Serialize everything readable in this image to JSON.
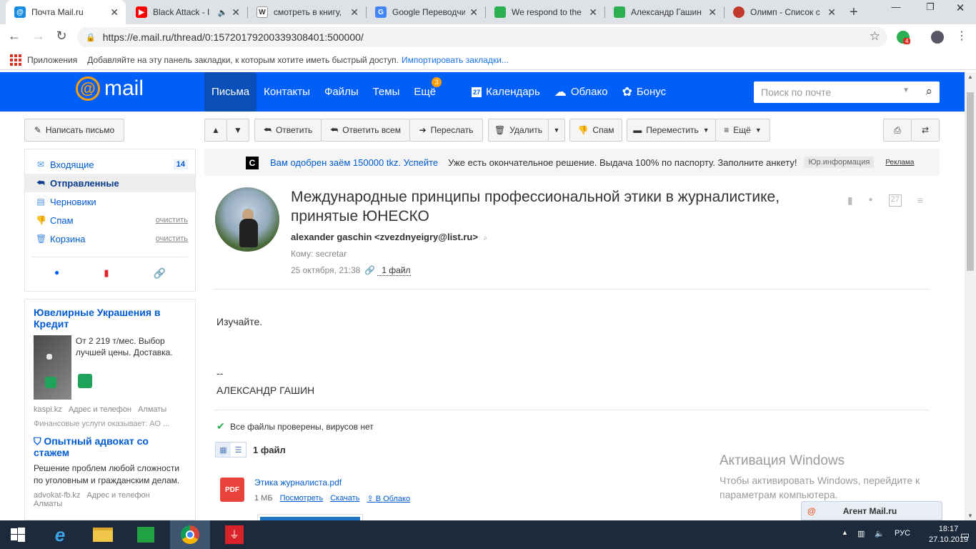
{
  "browser": {
    "tabs": [
      {
        "label": "Почта Mail.ru",
        "color": "#168de2"
      },
      {
        "label": "Black Attack - I",
        "color": "#ff0000"
      },
      {
        "label": "смотреть в книгу,",
        "color": "#555555"
      },
      {
        "label": "Google Переводчи",
        "color": "#4285f4"
      },
      {
        "label": "We respond to the",
        "color": "#2ab050"
      },
      {
        "label": "Александр Гашин",
        "color": "#2ab050"
      },
      {
        "label": "Олимп - Список с",
        "color": "#c0392b"
      }
    ],
    "url": "https://e.mail.ru/thread/0:15720179200339308401:500000/",
    "ext_badge": "4",
    "bookmarks": {
      "apps": "Приложения",
      "hint": "Добавляйте на эту панель закладки, к которым хотите иметь быстрый доступ.",
      "import": "Импортировать закладки..."
    }
  },
  "header": {
    "logo": "mail",
    "nav": [
      {
        "label": "Письма"
      },
      {
        "label": "Контакты"
      },
      {
        "label": "Файлы"
      },
      {
        "label": "Темы"
      },
      {
        "label": "Ещё",
        "badge": "3"
      },
      {
        "label": "Календарь",
        "icon": "27"
      },
      {
        "label": "Облако"
      },
      {
        "label": "Бонус"
      }
    ],
    "search_placeholder": "Поиск по почте"
  },
  "toolbar": {
    "compose": "Написать письмо",
    "reply": "Ответить",
    "reply_all": "Ответить всем",
    "forward": "Переслать",
    "delete": "Удалить",
    "spam": "Спам",
    "move": "Переместить",
    "more": "Ещё"
  },
  "folders": [
    {
      "label": "Входящие",
      "count": "14"
    },
    {
      "label": "Отправленные"
    },
    {
      "label": "Черновики"
    },
    {
      "label": "Спам",
      "action": "очистить"
    },
    {
      "label": "Корзина",
      "action": "очистить"
    }
  ],
  "ads": {
    "ad1": {
      "title": "Ювелирные Украшения в Кредит",
      "text": "От 2 219 т/мес. Выбор лучшей цены. Доставка.",
      "domain": "kaspi.kz",
      "extra": "Адрес и телефон",
      "city": "Алматы",
      "note": "Финансовые услуги оказывает: АО ..."
    },
    "ad2": {
      "title": "Опытный адвокат со стажем",
      "text": "Решение проблем любой сложности по уголовным и гражданским делам.",
      "domain": "advokat-fb.kz",
      "extra": "Адрес и телефон",
      "city": "Алматы"
    },
    "banner": {
      "blue": "Вам одобрен заём 150000 tkz. Успейте",
      "dark": "Уже есть окончательное решение. Выдача 100% по паспорту. Заполните анкету!",
      "jur": "Юр.информация",
      "rek": "Реклама"
    }
  },
  "message": {
    "subject": "Международные принципы профессиональной этики в журналистике, принятые ЮНЕСКО",
    "sender": "alexander gaschin <zvezdnyeigry@list.ru>",
    "to": "Кому: secretar",
    "date": "25 октября, 21:38",
    "files_link": "1 файл",
    "body": "Изучайте.",
    "sig_dash": "--",
    "sig_name": "АЛЕКСАНДР ГАШИН",
    "virus_check": "Все файлы проверены, вирусов нет",
    "files_count": "1 файл",
    "attachment": {
      "name": "Этика журналиста.pdf",
      "size": "1 МБ",
      "view": "Посмотреть",
      "download": "Скачать",
      "cloud": "В Облако",
      "type": "PDF"
    }
  },
  "watermark": {
    "title": "Активация Windows",
    "line1": "Чтобы активировать Windows, перейдите к",
    "line2": "параметрам компьютера."
  },
  "agent": "Агент Mail.ru",
  "taskbar": {
    "lang": "РУС",
    "time": "18:17",
    "date": "27.10.2019"
  }
}
